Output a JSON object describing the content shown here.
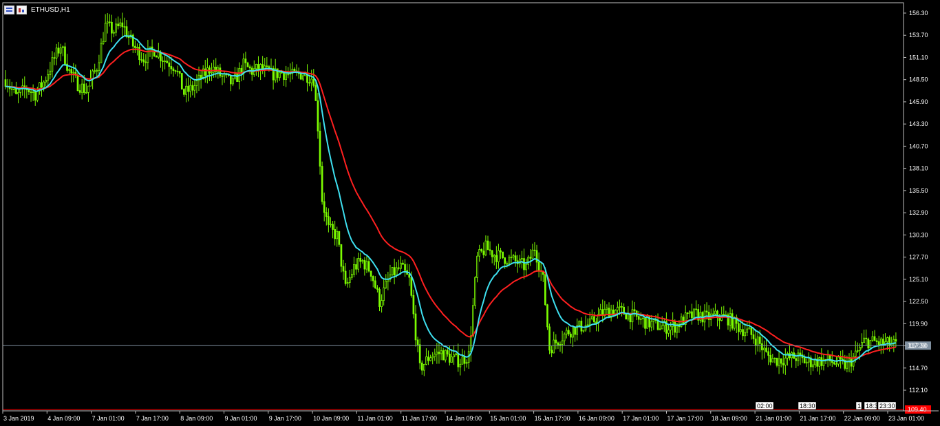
{
  "window": {
    "symbol_timeframe": "ETHUSD,H1"
  },
  "colors": {
    "background": "#000000",
    "candle": "#7cfc00",
    "ma_fast": "#3ee0f0",
    "ma_slow": "#ff2020",
    "current_price_line": "#7f8f9f",
    "bid_marker": "#ff0000",
    "axis": "#ffffff"
  },
  "chart_data": {
    "type": "candlestick",
    "title": "ETHUSD,H1",
    "ylim": [
      109.5,
      157.0
    ],
    "y_ticks": [
      "156.30",
      "153.70",
      "151.10",
      "148.50",
      "145.90",
      "143.30",
      "140.70",
      "138.10",
      "135.50",
      "132.90",
      "130.30",
      "127.70",
      "125.10",
      "122.50",
      "119.90",
      "117.30",
      "114.70",
      "112.10"
    ],
    "x_ticks": [
      "3 Jan 2019",
      "4 Jan 09:00",
      "7 Jan 01:00",
      "7 Jan 17:00",
      "8 Jan 09:00",
      "9 Jan 01:00",
      "9 Jan 17:00",
      "10 Jan 09:00",
      "11 Jan 01:00",
      "11 Jan 17:00",
      "14 Jan 09:00",
      "15 Jan 01:00",
      "15 Jan 17:00",
      "16 Jan 09:00",
      "17 Jan 01:00",
      "17 Jan 17:00",
      "18 Jan 09:00",
      "21 Jan 01:00",
      "21 Jan 17:00",
      "22 Jan 09:00",
      "23 Jan 01:00"
    ],
    "current_price": {
      "label": "117.33",
      "value": 117.33
    },
    "bid_marker": {
      "label": "109.40",
      "value": 109.4
    },
    "time_markers": [
      "02:00",
      "18:30",
      "1",
      "18:3",
      "23:30"
    ],
    "grid": false,
    "price_path": [
      [
        0,
        148.5
      ],
      [
        5,
        146.5
      ],
      [
        10,
        147.5
      ],
      [
        14,
        146.8
      ],
      [
        18,
        148.2
      ],
      [
        22,
        150.5
      ],
      [
        26,
        152.5
      ],
      [
        30,
        149.5
      ],
      [
        34,
        148.0
      ],
      [
        38,
        147.2
      ],
      [
        43,
        150.0
      ],
      [
        47,
        154.8
      ],
      [
        51,
        154.2
      ],
      [
        55,
        155.0
      ],
      [
        60,
        152.5
      ],
      [
        65,
        151.0
      ],
      [
        70,
        152.0
      ],
      [
        75,
        150.8
      ],
      [
        80,
        150.0
      ],
      [
        84,
        146.9
      ],
      [
        88,
        147.5
      ],
      [
        93,
        149.0
      ],
      [
        97,
        150.0
      ],
      [
        102,
        148.8
      ],
      [
        107,
        148.0
      ],
      [
        112,
        150.2
      ],
      [
        116,
        149.5
      ],
      [
        120,
        149.8
      ],
      [
        125,
        149.1
      ],
      [
        130,
        149.3
      ],
      [
        135,
        149.0
      ],
      [
        140,
        149.2
      ],
      [
        145,
        148.6
      ],
      [
        147,
        143.0
      ],
      [
        149,
        134.5
      ],
      [
        152,
        131.0
      ],
      [
        156,
        130.2
      ],
      [
        160,
        124.0
      ],
      [
        164,
        126.5
      ],
      [
        168,
        127.2
      ],
      [
        172,
        126.0
      ],
      [
        176,
        122.5
      ],
      [
        181,
        125.5
      ],
      [
        186,
        126.5
      ],
      [
        190,
        125.0
      ],
      [
        195,
        114.6
      ],
      [
        200,
        116.2
      ],
      [
        205,
        116.5
      ],
      [
        210,
        115.8
      ],
      [
        214,
        115.5
      ],
      [
        218,
        116.2
      ],
      [
        222,
        127.5
      ],
      [
        226,
        128.8
      ],
      [
        230,
        128.0
      ],
      [
        235,
        127.6
      ],
      [
        240,
        127.2
      ],
      [
        245,
        126.5
      ],
      [
        249,
        128.8
      ],
      [
        253,
        125.0
      ],
      [
        256,
        117.0
      ],
      [
        260,
        118.0
      ],
      [
        265,
        119.0
      ],
      [
        270,
        119.5
      ],
      [
        275,
        119.8
      ],
      [
        280,
        121.0
      ],
      [
        285,
        121.5
      ],
      [
        290,
        121.3
      ],
      [
        295,
        120.8
      ],
      [
        300,
        120.2
      ],
      [
        305,
        119.8
      ],
      [
        310,
        119.5
      ],
      [
        315,
        119.6
      ],
      [
        320,
        120.5
      ],
      [
        325,
        121.0
      ],
      [
        330,
        120.6
      ],
      [
        335,
        120.8
      ],
      [
        340,
        120.5
      ],
      [
        345,
        119.5
      ],
      [
        350,
        118.8
      ],
      [
        354,
        117.9
      ],
      [
        358,
        116.3
      ],
      [
        362,
        115.6
      ],
      [
        367,
        115.8
      ],
      [
        372,
        116.0
      ],
      [
        377,
        115.4
      ],
      [
        382,
        115.5
      ],
      [
        387,
        115.6
      ],
      [
        392,
        115.2
      ],
      [
        396,
        115.0
      ],
      [
        400,
        116.2
      ],
      [
        404,
        117.8
      ],
      [
        408,
        117.8
      ],
      [
        412,
        117.6
      ],
      [
        416,
        117.5
      ],
      [
        420,
        117.33
      ]
    ],
    "candle_count": 420
  }
}
